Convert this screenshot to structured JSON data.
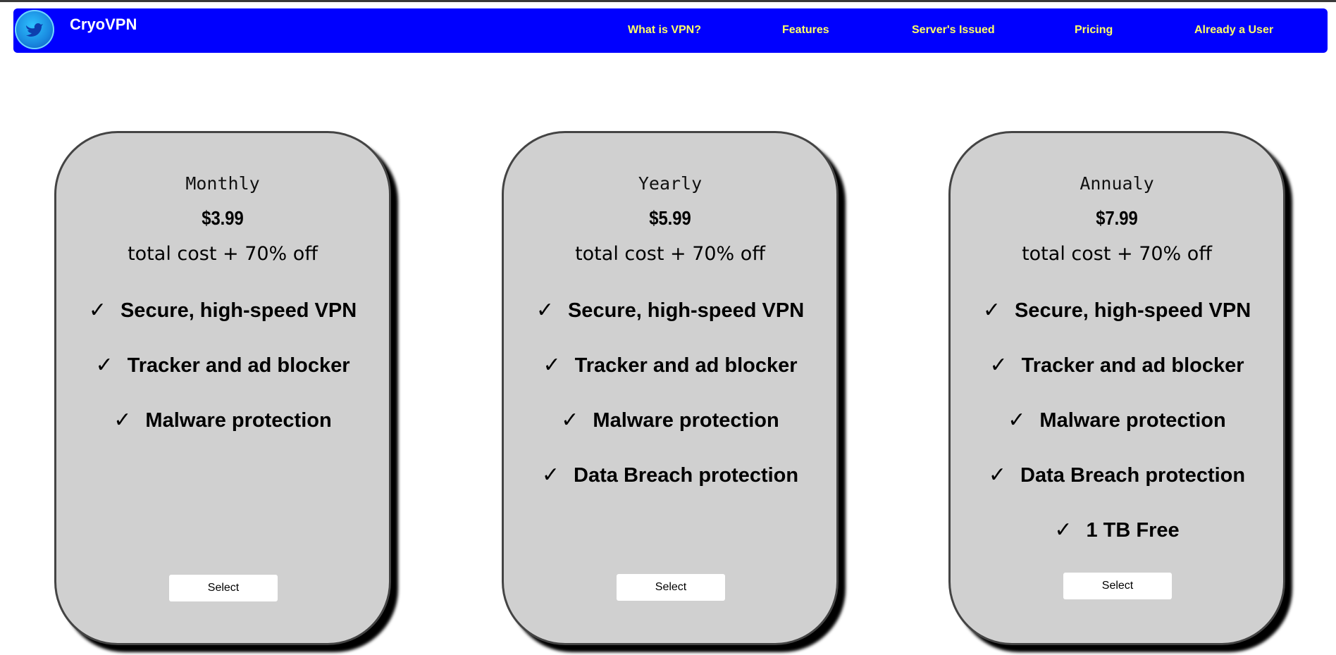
{
  "header": {
    "brand": "CryoVPN",
    "logo_icon": "bird-icon",
    "nav": [
      {
        "label": "What is VPN?"
      },
      {
        "label": "Features"
      },
      {
        "label": "Server's Issued"
      },
      {
        "label": "Pricing"
      },
      {
        "label": "Already a User"
      }
    ]
  },
  "colors": {
    "navbar_bg": "#0000ff",
    "nav_link": "#ffff66",
    "card_bg": "#d0d0d0"
  },
  "plans": [
    {
      "name": "Monthly",
      "price": "$3.99",
      "note": "total cost + 70% off",
      "check_icon": "✓",
      "features": [
        "Secure, high-speed VPN",
        "Tracker and ad blocker",
        "Malware protection"
      ],
      "button": "Select"
    },
    {
      "name": "Yearly",
      "price": "$5.99",
      "note": "total cost + 70% off",
      "check_icon": "✓",
      "features": [
        "Secure, high-speed VPN",
        "Tracker and ad blocker",
        "Malware protection",
        "Data Breach protection"
      ],
      "button": "Select"
    },
    {
      "name": "Annualy",
      "price": "$7.99",
      "note": "total cost + 70% off",
      "check_icon": "✓",
      "features": [
        "Secure, high-speed VPN",
        "Tracker and ad blocker",
        "Malware protection",
        "Data Breach protection",
        "1 TB Free"
      ],
      "button": "Select"
    }
  ]
}
